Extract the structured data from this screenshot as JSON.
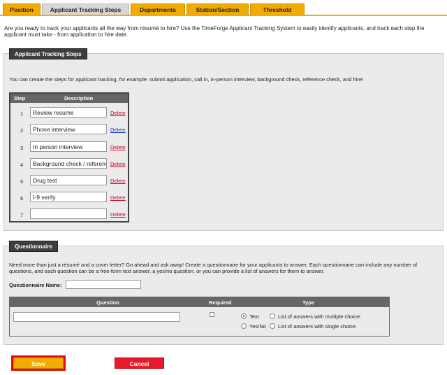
{
  "tabs": [
    {
      "label": "Position",
      "active": false
    },
    {
      "label": "Applicant Tracking Steps",
      "active": true
    },
    {
      "label": "Departments",
      "active": false
    },
    {
      "label": "Station/Section",
      "active": false
    },
    {
      "label": "Threshold",
      "active": false
    }
  ],
  "intro": "Are you ready to track your applicants all the way from résumé to hire? Use the TimeForge Applicant Tracking System to easily identify applicants, and track each step the applicant must take - from application to hire date.",
  "tracking": {
    "legend": "Applicant Tracking Steps",
    "description": "You can create the steps for applicant tracking, for example: submit application, call in, in-person interview, background check, reference check, and hire!",
    "col_step": "Step",
    "col_description": "Description",
    "delete_label": "Delete",
    "steps": [
      {
        "num": "1",
        "value": "Review resume"
      },
      {
        "num": "2",
        "value": "Phone interview"
      },
      {
        "num": "3",
        "value": "In person interview"
      },
      {
        "num": "4",
        "value": "Background check / reference check"
      },
      {
        "num": "5",
        "value": "Drug test"
      },
      {
        "num": "6",
        "value": "I-9 verify"
      },
      {
        "num": "7",
        "value": ""
      }
    ]
  },
  "questionnaire": {
    "legend": "Questionnaire",
    "description": "Need more than just a résumé and a cover letter? Go ahead and ask away! Create a questionnaire for your applicants to answer. Each questionnaire can include any number of questions, and each question can be a free-form text answer, a yes/no question, or you can provide a list of answers for them to answer.",
    "name_label": "Questionnaire Name:",
    "name_value": "",
    "col_question": "Question",
    "col_required": "Required",
    "col_type": "Type",
    "question_value": "",
    "required_checked": false,
    "type_options": {
      "text": "Text",
      "yesno": "Yes/No",
      "multi": "List of answers with multiple choice.",
      "single": "List of answers with single choice."
    },
    "selected_type": "Text"
  },
  "buttons": {
    "save": "Save",
    "cancel": "Cancel"
  },
  "colors": {
    "tab_orange": "#f2ab00",
    "save_outline": "#e01010",
    "cancel_red": "#e8192b",
    "delete_red": "#d0002a"
  }
}
